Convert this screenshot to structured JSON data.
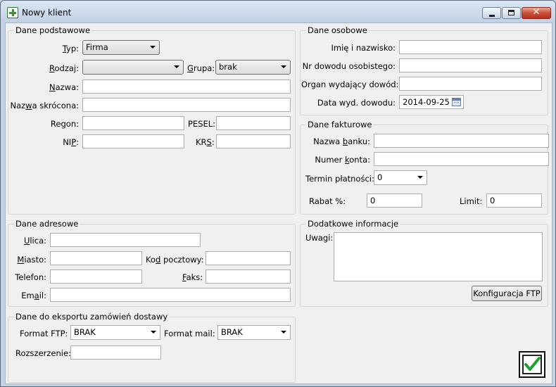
{
  "window": {
    "title": "Nowy klient",
    "close_glyph": "✕"
  },
  "podstawowe": {
    "title": "Dane podstawowe",
    "typ_label": "Typ:",
    "typ_value": "Firma",
    "rodzaj_label": "Rodzaj:",
    "rodzaj_value": "",
    "grupa_label": "Grupa:",
    "grupa_value": "brak",
    "nazwa_label": "Nazwa:",
    "nazwa_value": "",
    "nazwa_skr_label": "Nazwa skrócona:",
    "nazwa_skr_value": "",
    "regon_label": "Regon:",
    "regon_value": "",
    "pesel_label": "PESEL:",
    "pesel_value": "",
    "nip_label": "NIP:",
    "nip_value": "",
    "krs_label": "KRS:",
    "krs_value": ""
  },
  "osobowe": {
    "title": "Dane osobowe",
    "imie_label": "Imię i nazwisko:",
    "imie_value": "",
    "nr_dowodu_label": "Nr dowodu osobistego:",
    "nr_dowodu_value": "",
    "organ_label": "Organ wydający dowód:",
    "organ_value": "",
    "data_label": "Data wyd. dowodu:",
    "data_value": "2014-09-25"
  },
  "fakturowe": {
    "title": "Dane fakturowe",
    "bank_label": "Nazwa banku:",
    "bank_value": "",
    "konto_label": "Numer konta:",
    "konto_value": "",
    "termin_label": "Termin płatności:",
    "termin_value": "0",
    "rabat_label": "Rabat %:",
    "rabat_value": "0",
    "limit_label": "Limit:",
    "limit_value": "0"
  },
  "adresowe": {
    "title": "Dane adresowe",
    "ulica_label": "Ulica:",
    "ulica_value": "",
    "miasto_label": "Miasto:",
    "miasto_value": "",
    "kod_label": "Kod pocztowy:",
    "kod_value": "",
    "telefon_label": "Telefon:",
    "telefon_value": "",
    "faks_label": "Faks:",
    "faks_value": "",
    "email_label": "Email:",
    "email_value": ""
  },
  "dodatkowe": {
    "title": "Dodatkowe informacje",
    "uwagi_label": "Uwagi:",
    "uwagi_value": "",
    "ftp_button": "Konfiguracja FTP"
  },
  "eksport": {
    "title": "Dane do eksportu zamówień dostawy",
    "ftp_label": "Format FTP:",
    "ftp_value": "BRAK",
    "mail_label": "Format mail:",
    "mail_value": "BRAK",
    "rozszerzenie_label": "Rozszerzenie:",
    "rozszerzenie_value": ""
  },
  "colors": {
    "accent_check": "#1fa12f",
    "close_red": "#c8513b"
  }
}
